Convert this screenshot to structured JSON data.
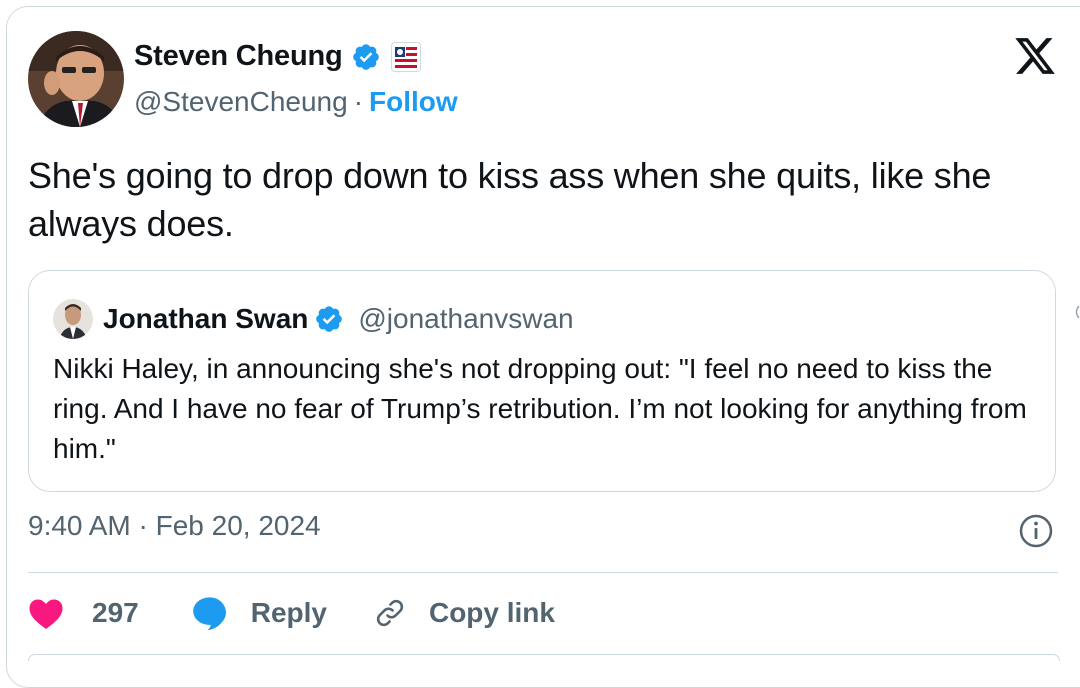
{
  "author": {
    "name": "Steven Cheung",
    "handle": "@StevenCheung",
    "separator": "·",
    "follow_label": "Follow",
    "avatar_icon": "avatar-photo",
    "verified_icon": "verified-badge-icon",
    "affiliation_icon": "affiliation-badge-icon"
  },
  "tweet": {
    "text": "She's going to drop down to kiss ass when she quits, like she always does."
  },
  "quoted": {
    "name": "Jonathan Swan",
    "handle": "@jonathanvswan",
    "text": "Nikki Haley, in announcing she's not dropping out: \"I feel no need to kiss the ring. And I have no fear of Trump’s retribution. I’m not looking for anything from him.\""
  },
  "meta": {
    "timestamp": "9:40 AM · Feb 20, 2024"
  },
  "actions": {
    "like_count": "297",
    "reply_label": "Reply",
    "copy_link_label": "Copy link"
  },
  "colors": {
    "accent": "#1d9bf0",
    "like": "#f91880",
    "text": "#0f1419",
    "muted": "#536471",
    "border": "#cfd9de"
  }
}
